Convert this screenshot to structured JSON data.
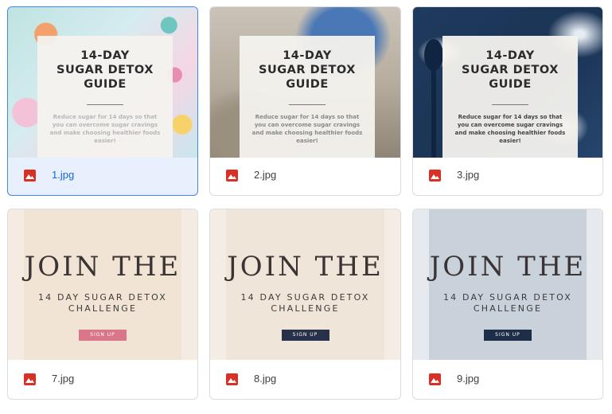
{
  "files": [
    {
      "name": "1.jpg",
      "selected": true
    },
    {
      "name": "2.jpg"
    },
    {
      "name": "3.jpg"
    },
    {
      "name": "7.jpg"
    },
    {
      "name": "8.jpg"
    },
    {
      "name": "9.jpg"
    }
  ],
  "guide": {
    "title": "14-DAY\nSUGAR DETOX\nGUIDE",
    "subtitle": "Reduce sugar for 14 days so that you can overcome sugar cravings and make choosing healthier foods easier!"
  },
  "challenge": {
    "title": "JOIN THE",
    "subtitle": "14 DAY SUGAR DETOX\nCHALLENGE",
    "button": "SIGN UP"
  },
  "colors": {
    "file_icon": "#d93025",
    "selected_bg": "#e8f0fe",
    "selected_border": "#4285f4"
  },
  "icons": {
    "file_type": "image-file-icon"
  }
}
